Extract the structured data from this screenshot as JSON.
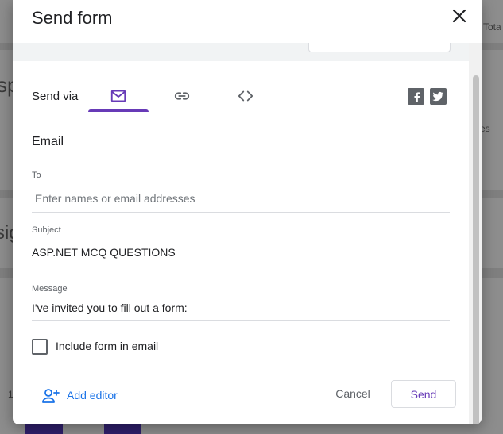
{
  "background": {
    "text_total": "Tota",
    "text_asp": "sp",
    "text_es": "es",
    "text_sig": "sig",
    "text_one": "1"
  },
  "dialog": {
    "title": "Send form",
    "send_via_label": "Send via",
    "tabs": [
      {
        "name": "email",
        "icon": "mail-icon",
        "active": true
      },
      {
        "name": "link",
        "icon": "link-icon",
        "active": false
      },
      {
        "name": "embed",
        "icon": "code-icon",
        "active": false
      }
    ],
    "social": [
      "facebook-icon",
      "twitter-icon"
    ],
    "section_title": "Email",
    "to": {
      "label": "To",
      "value": "",
      "placeholder": "Enter names or email addresses"
    },
    "subject": {
      "label": "Subject",
      "value": "ASP.NET MCQ QUESTIONS"
    },
    "message": {
      "label": "Message",
      "value": "I've invited you to fill out a form:"
    },
    "include_form": {
      "label": "Include form in email",
      "checked": false
    },
    "add_editor_label": "Add editor",
    "cancel_label": "Cancel",
    "send_label": "Send"
  },
  "colors": {
    "accent": "#673ab7",
    "link": "#1a73e8",
    "overlay": "#8d8d8d"
  }
}
